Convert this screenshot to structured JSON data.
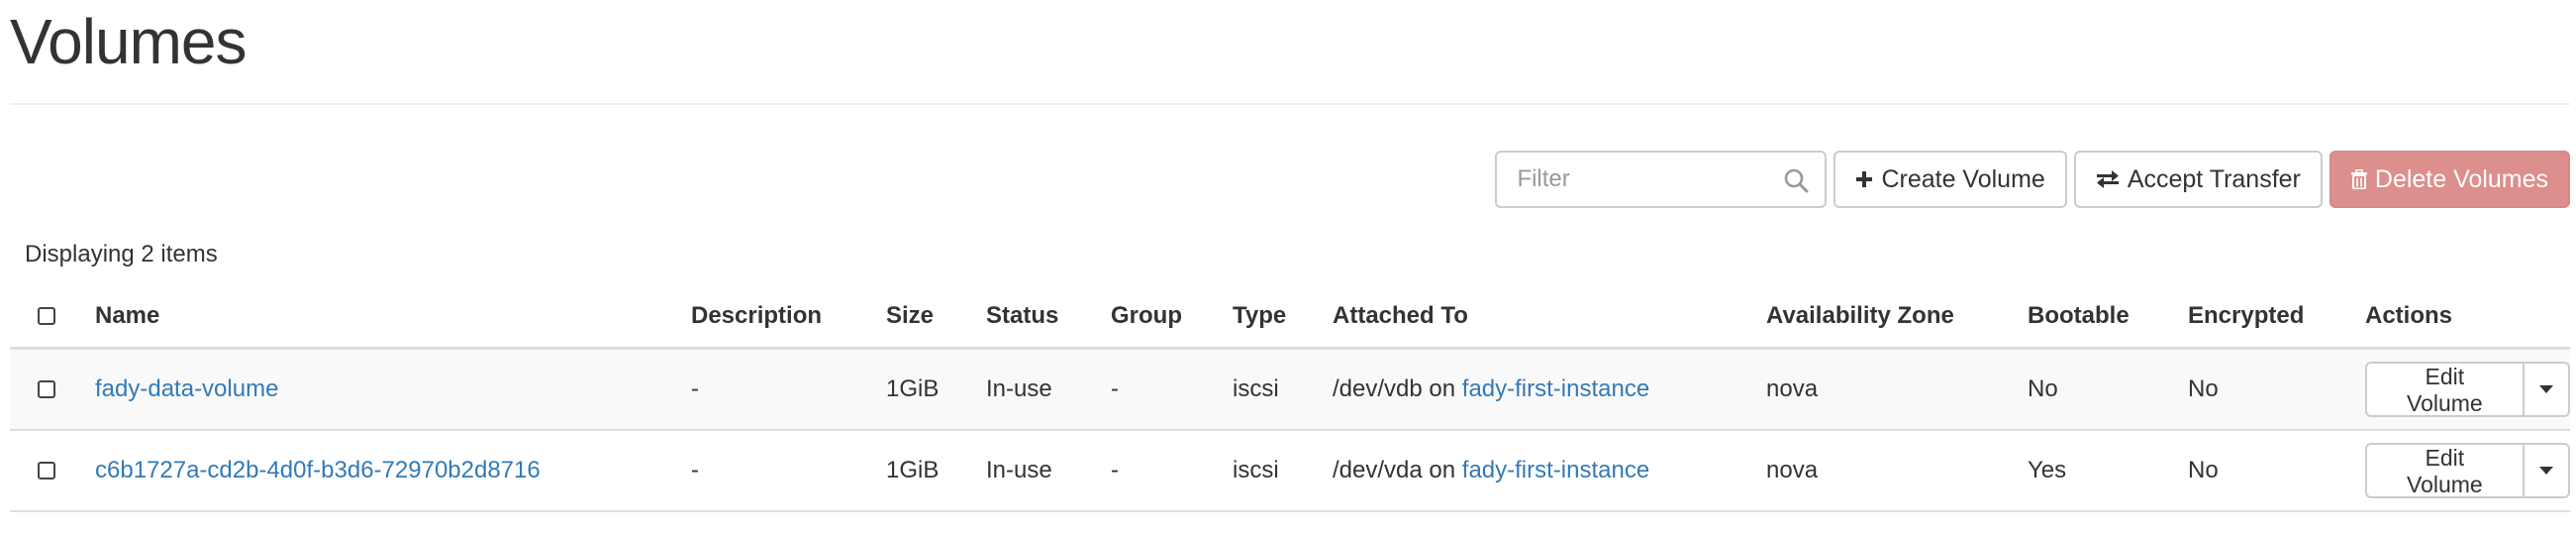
{
  "page": {
    "title": "Volumes"
  },
  "toolbar": {
    "filter_placeholder": "Filter",
    "create_label": "Create Volume",
    "accept_transfer_label": "Accept Transfer",
    "delete_label": "Delete Volumes",
    "icons": {
      "search": "search-icon",
      "create": "plus-icon",
      "transfer": "exchange-icon",
      "delete": "trash-icon"
    }
  },
  "table": {
    "summary": "Displaying 2 items",
    "columns": [
      "Name",
      "Description",
      "Size",
      "Status",
      "Group",
      "Type",
      "Attached To",
      "Availability Zone",
      "Bootable",
      "Encrypted",
      "Actions"
    ],
    "rows": [
      {
        "name": "fady-data-volume",
        "description": "-",
        "size": "1GiB",
        "status": "In-use",
        "group": "-",
        "type": "iscsi",
        "attached_device": "/dev/vdb",
        "attached_on": "on",
        "attached_instance": "fady-first-instance",
        "availability_zone": "nova",
        "bootable": "No",
        "encrypted": "No",
        "action_label": "Edit Volume"
      },
      {
        "name": "c6b1727a-cd2b-4d0f-b3d6-72970b2d8716",
        "description": "-",
        "size": "1GiB",
        "status": "In-use",
        "group": "-",
        "type": "iscsi",
        "attached_device": "/dev/vda",
        "attached_on": "on",
        "attached_instance": "fady-first-instance",
        "availability_zone": "nova",
        "bootable": "Yes",
        "encrypted": "No",
        "action_label": "Edit Volume"
      }
    ]
  },
  "colors": {
    "link": "#337ab7",
    "danger_button": "#dc8f8d",
    "text": "#333333",
    "border": "#dddddd"
  }
}
